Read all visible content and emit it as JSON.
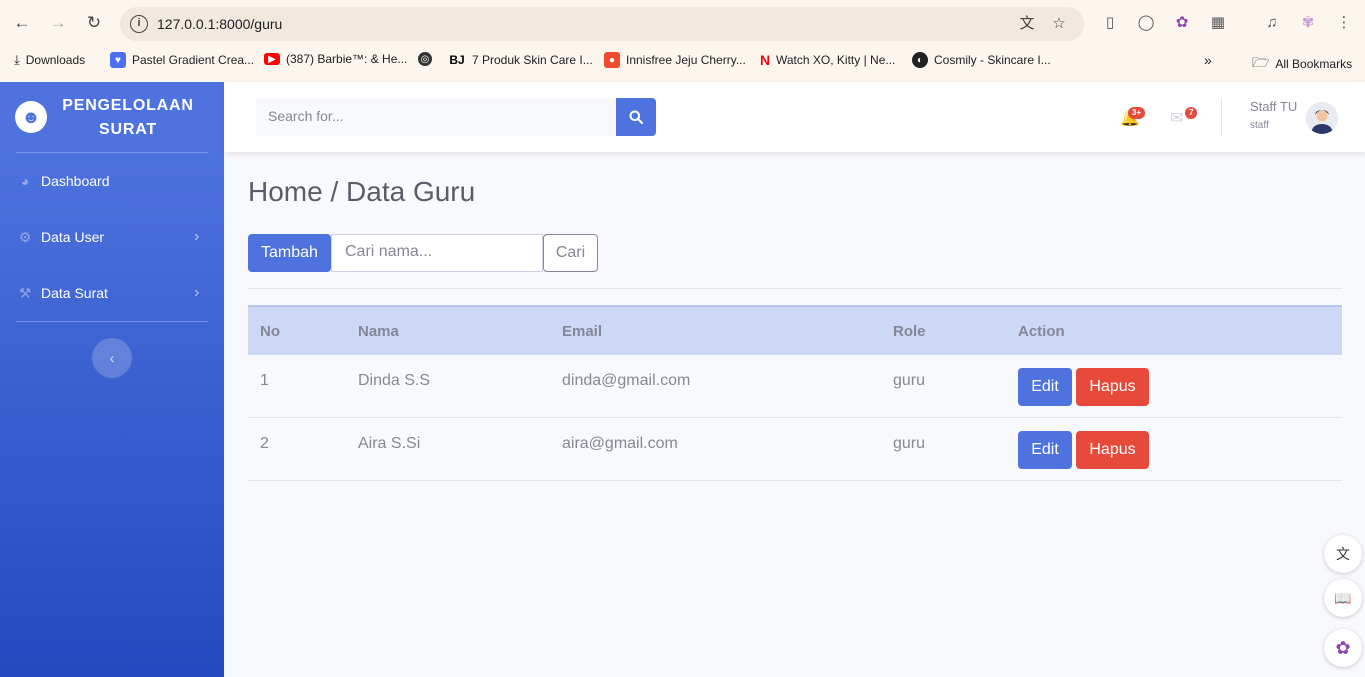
{
  "browser": {
    "url": "127.0.0.1:8000/guru",
    "bookmarks": [
      {
        "label": "Downloads",
        "icon": "download-icon"
      },
      {
        "label": "Pastel Gradient Crea...",
        "icon": "heart-icon"
      },
      {
        "label": "(387) Barbie™: & He...",
        "icon": "youtube-icon"
      },
      {
        "label": "",
        "icon": "globe-icon"
      },
      {
        "label": "7 Produk Skin Care I...",
        "icon": "bj-icon",
        "badge": "BJ"
      },
      {
        "label": "Innisfree Jeju Cherry...",
        "icon": "shopee-icon"
      },
      {
        "label": "Watch XO, Kitty | Ne...",
        "icon": "netflix-icon",
        "badge": "N"
      },
      {
        "label": "Cosmily - Skincare I...",
        "icon": "cosmily-icon"
      }
    ],
    "all_bookmarks": "All Bookmarks"
  },
  "sidebar": {
    "brand": "PENGELOLAAN SURAT",
    "items": [
      {
        "label": "Dashboard",
        "icon": "tachometer-icon"
      },
      {
        "label": "Data User",
        "icon": "cog-icon"
      },
      {
        "label": "Data Surat",
        "icon": "wrench-icon"
      }
    ]
  },
  "topbar": {
    "search_placeholder": "Search for...",
    "alerts_badge": "3+",
    "messages_badge": "7",
    "user_name": "Staff TU",
    "user_role": "staff"
  },
  "main": {
    "title": "Home / Data Guru",
    "add_button": "Tambah",
    "search_placeholder": "Cari nama...",
    "search_button": "Cari",
    "table": {
      "headers": [
        "No",
        "Nama",
        "Email",
        "Role",
        "Action"
      ],
      "rows": [
        {
          "no": "1",
          "nama": "Dinda S.S",
          "email": "dinda@gmail.com",
          "role": "guru"
        },
        {
          "no": "2",
          "nama": "Aira S.Si",
          "email": "aira@gmail.com",
          "role": "guru"
        }
      ],
      "edit_label": "Edit",
      "delete_label": "Hapus"
    }
  },
  "colors": {
    "primary": "#4e73df",
    "danger": "#e74a3b",
    "sidebar_end": "#224abe",
    "table_header": "#cdd7f6"
  }
}
